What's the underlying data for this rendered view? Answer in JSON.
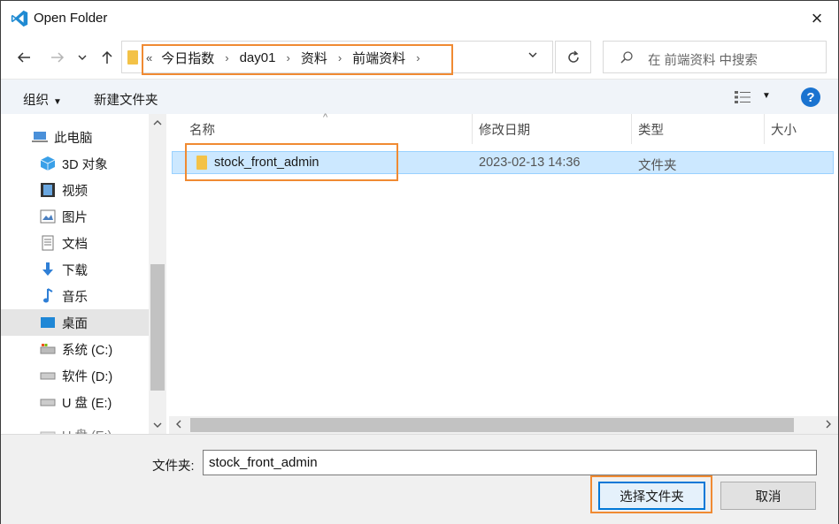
{
  "window": {
    "title": "Open Folder",
    "close_glyph": "×"
  },
  "address": {
    "lead": "«",
    "crumbs": [
      "今日指数",
      "day01",
      "资料",
      "前端资料"
    ],
    "search_placeholder": "在 前端资料 中搜索"
  },
  "toolbar": {
    "organize_label": "组织",
    "new_folder_label": "新建文件夹",
    "help_label": "?"
  },
  "nav": {
    "items": [
      {
        "label": "此电脑",
        "icon": "computer-icon"
      },
      {
        "label": "3D 对象",
        "icon": "cube-3d-icon"
      },
      {
        "label": "视频",
        "icon": "video-icon"
      },
      {
        "label": "图片",
        "icon": "picture-icon"
      },
      {
        "label": "文档",
        "icon": "document-icon"
      },
      {
        "label": "下载",
        "icon": "download-icon"
      },
      {
        "label": "音乐",
        "icon": "music-icon"
      },
      {
        "label": "桌面",
        "icon": "desktop-icon",
        "selected": true
      },
      {
        "label": "系统 (C:)",
        "icon": "drive-c-icon"
      },
      {
        "label": "软件 (D:)",
        "icon": "drive-icon"
      },
      {
        "label": "U 盘 (E:)",
        "icon": "drive-icon"
      }
    ],
    "partial_item": "U 盘 (E:)"
  },
  "columns": {
    "name": "名称",
    "modified": "修改日期",
    "type": "类型",
    "size": "大小"
  },
  "files": [
    {
      "name": "stock_front_admin",
      "modified": "2023-02-13 14:36",
      "type": "文件夹"
    }
  ],
  "footer": {
    "folder_label": "文件夹:",
    "folder_value": "stock_front_admin",
    "select_button": "选择文件夹",
    "cancel_button": "取消"
  },
  "colors": {
    "highlight": "#f08a32",
    "selection": "#cce8ff",
    "accent": "#0078d7"
  }
}
